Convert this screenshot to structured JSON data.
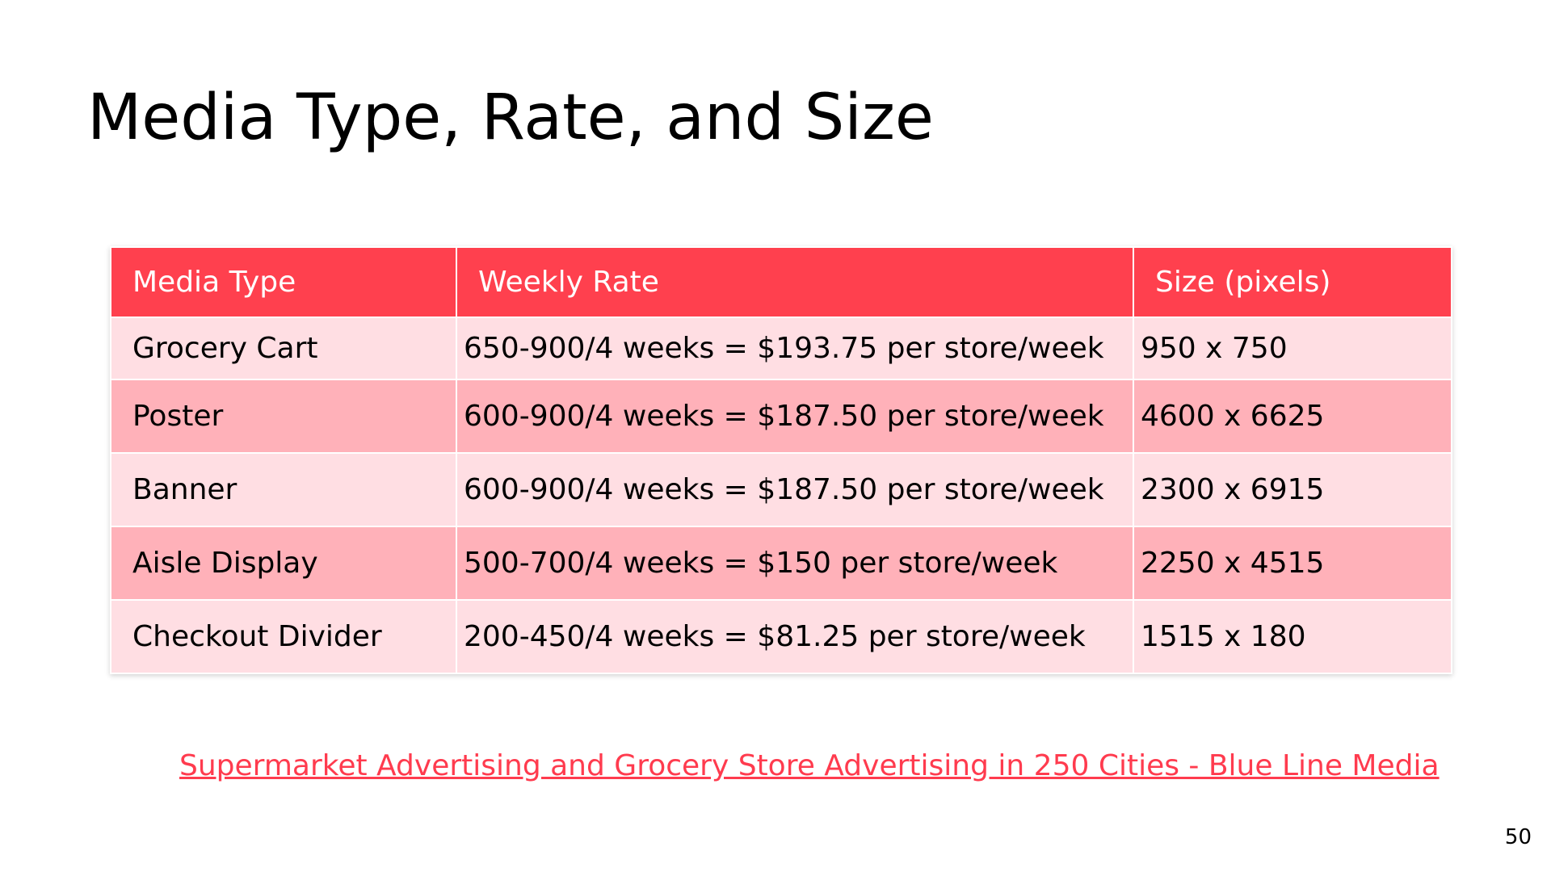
{
  "slide": {
    "title": "Media Type, Rate, and Size",
    "number": "50"
  },
  "table": {
    "headers": [
      "Media Type",
      "Weekly Rate",
      "Size (pixels)"
    ],
    "rows": [
      [
        "Grocery Cart",
        "650-900/4 weeks = $193.75 per store/week",
        "950 x 750"
      ],
      [
        "Poster",
        "600-900/4 weeks = $187.50 per store/week",
        "4600 x 6625"
      ],
      [
        "Banner",
        "600-900/4 weeks = $187.50 per store/week",
        "2300 x 6915"
      ],
      [
        "Aisle Display",
        "500-700/4 weeks = $150 per store/week",
        "2250 x 4515"
      ],
      [
        "Checkout Divider",
        "200-450/4 weeks = $81.25 per store/week",
        "1515 x 180"
      ]
    ]
  },
  "source": {
    "link_text": "Supermarket Advertising and Grocery Store Advertising in 250 Cities - Blue Line Media"
  },
  "colors": {
    "header_bg": "#ff404e",
    "row_light": "#ffdee3",
    "row_dark": "#ffb1b9",
    "link": "#ff3b4e"
  }
}
